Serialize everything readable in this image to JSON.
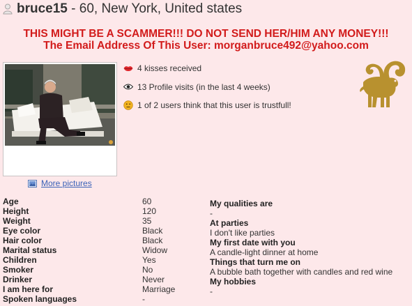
{
  "profile": {
    "username": "bruce15",
    "summary": " - 60, New York, United states"
  },
  "warning": {
    "line1": "THIS MIGHT BE A SCAMMER!!! DO NOT SEND HER/HIM ANY MONEY!!!",
    "line2": "The Email Address Of This User: morganbruce492@yahoo.com"
  },
  "more_pictures_label": "More pictures",
  "stats": [
    {
      "icon": "lips-icon",
      "text": "4 kisses received"
    },
    {
      "icon": "eye-icon",
      "text": "13 Profile visits (in the last 4 weeks)"
    },
    {
      "icon": "smiley-icon",
      "text": "1 of 2 users think that this user is trustfull!"
    }
  ],
  "zodiac_icon": "aries-icon",
  "details": [
    {
      "label": "Age",
      "value": "60"
    },
    {
      "label": "Height",
      "value": "120"
    },
    {
      "label": "Weight",
      "value": "35"
    },
    {
      "label": "Eye color",
      "value": "Black"
    },
    {
      "label": "Hair color",
      "value": "Black"
    },
    {
      "label": "Marital status",
      "value": "Widow"
    },
    {
      "label": "Children",
      "value": "Yes"
    },
    {
      "label": "Smoker",
      "value": "No"
    },
    {
      "label": "Drinker",
      "value": "Never"
    },
    {
      "label": "I am here for",
      "value": "Marriage"
    },
    {
      "label": "Spoken languages",
      "value": "-"
    }
  ],
  "qualities": {
    "qualities_heading": "My qualities are",
    "qualities_value": "-",
    "parties_heading": "At parties",
    "parties_value": "I don't like parties",
    "first_date_heading": "My first date with you",
    "first_date_value": "A candle-light dinner at home",
    "turn_on_heading": "Things that turn me on",
    "turn_on_value": "A bubble bath together with candles and red wine",
    "hobbies_heading": "My hobbies",
    "hobbies_value": "-"
  },
  "colors": {
    "background": "#fde8ea",
    "warning": "#d21b1b",
    "link": "#3a62b8",
    "zodiac_gold": "#b8912f"
  }
}
